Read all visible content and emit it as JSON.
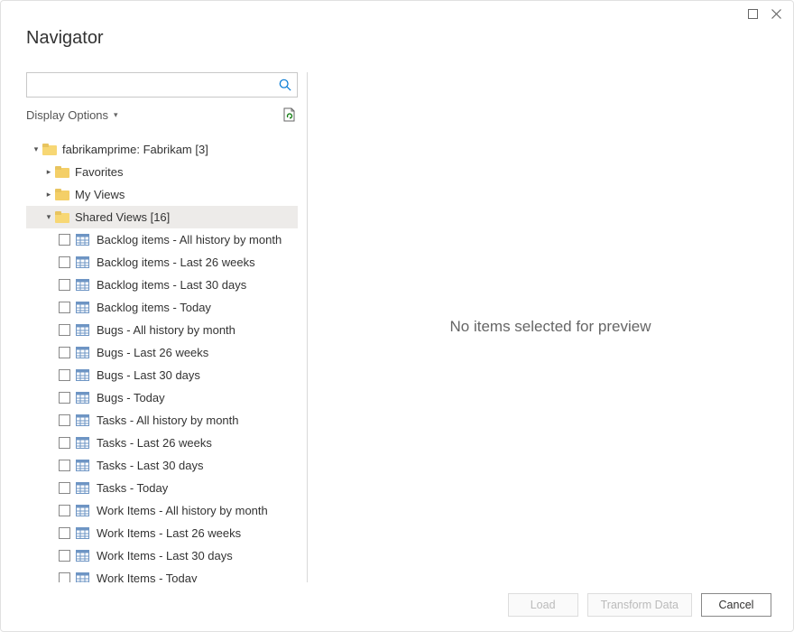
{
  "title": "Navigator",
  "search": {
    "placeholder": ""
  },
  "display_options_label": "Display Options",
  "tree": {
    "root": {
      "label": "fabrikamprime: Fabrikam [3]"
    },
    "favorites": {
      "label": "Favorites"
    },
    "my_views": {
      "label": "My Views"
    },
    "shared_views": {
      "label": "Shared Views [16]"
    },
    "shared_items": [
      {
        "label": "Backlog items - All history by month"
      },
      {
        "label": "Backlog items - Last 26 weeks"
      },
      {
        "label": "Backlog items - Last 30 days"
      },
      {
        "label": "Backlog items - Today"
      },
      {
        "label": "Bugs - All history by month"
      },
      {
        "label": "Bugs - Last 26 weeks"
      },
      {
        "label": "Bugs - Last 30 days"
      },
      {
        "label": "Bugs - Today"
      },
      {
        "label": "Tasks - All history by month"
      },
      {
        "label": "Tasks - Last 26 weeks"
      },
      {
        "label": "Tasks - Last 30 days"
      },
      {
        "label": "Tasks - Today"
      },
      {
        "label": "Work Items - All history by month"
      },
      {
        "label": "Work Items - Last 26 weeks"
      },
      {
        "label": "Work Items - Last 30 days"
      },
      {
        "label": "Work Items - Today"
      }
    ]
  },
  "preview_placeholder": "No items selected for preview",
  "buttons": {
    "load": "Load",
    "transform": "Transform Data",
    "cancel": "Cancel"
  }
}
